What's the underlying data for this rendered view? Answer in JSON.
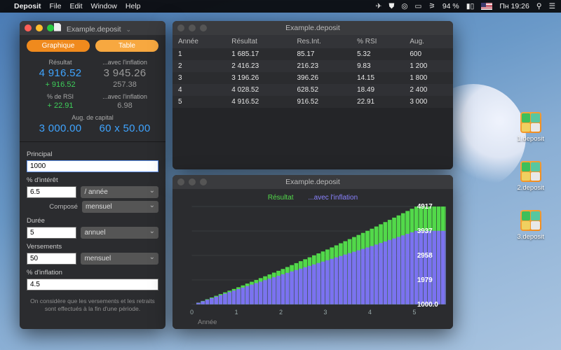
{
  "menubar": {
    "app": "Deposit",
    "items": [
      "File",
      "Edit",
      "Window",
      "Help"
    ],
    "battery": "94 %",
    "clock": "Пн 19:26"
  },
  "mainWindow": {
    "title": "Example.deposit",
    "tabs": {
      "graph": "Graphique",
      "table": "Table"
    },
    "summary": {
      "hdr_result": "Résultat",
      "hdr_infl": "...avec l'inflation",
      "result": "4 916.52",
      "result_infl": "3 945.26",
      "gain": "+ 916.52",
      "gain_infl": "257.38",
      "hdr_rsi": "% de RSI",
      "rsi": "+ 22.91",
      "rsi_infl": "6.98",
      "hdr_aug": "Aug. de capital",
      "aug": "3 000.00",
      "aug2": "60 x 50.00"
    },
    "form": {
      "principal_lbl": "Principal",
      "principal": "1000",
      "interest_lbl": "% d'intérêt",
      "interest": "6.5",
      "per_year": "/ année",
      "compound_lbl": "Composé",
      "compound": "mensuel",
      "duration_lbl": "Durée",
      "duration": "5",
      "duration_unit": "annuel",
      "payments_lbl": "Versements",
      "payments": "50",
      "payments_unit": "mensuel",
      "inflation_lbl": "% d'inflation",
      "inflation": "4.5",
      "footnote": "On considère que les versements et les retraits sont effectués à la fin d'une période."
    }
  },
  "tableWindow": {
    "title": "Example.deposit",
    "columns": [
      "Année",
      "Résultat",
      "Res.Int.",
      "% RSI",
      "Aug."
    ],
    "rows": [
      [
        "1",
        "1 685.17",
        "85.17",
        "5.32",
        "600"
      ],
      [
        "2",
        "2 416.23",
        "216.23",
        "9.83",
        "1 200"
      ],
      [
        "3",
        "3 196.26",
        "396.26",
        "14.15",
        "1 800"
      ],
      [
        "4",
        "4 028.52",
        "628.52",
        "18.49",
        "2 400"
      ],
      [
        "5",
        "4 916.52",
        "916.52",
        "22.91",
        "3 000"
      ]
    ]
  },
  "chartWindow": {
    "title": "Example.deposit",
    "legend": {
      "s1": "Résultat",
      "s2": "...avec l'inflation"
    },
    "xlabel": "Année"
  },
  "chart_data": {
    "type": "bar",
    "title": "",
    "xlabel": "Année",
    "ylabel": "",
    "categories": [
      0,
      1,
      2,
      3,
      4,
      5
    ],
    "series": [
      {
        "name": "Résultat",
        "values": [
          1000,
          1685.17,
          2416.23,
          3196.26,
          4028.52,
          4916.52
        ]
      },
      {
        "name": "...avec l'inflation",
        "values": [
          1000,
          1612,
          2205,
          2767,
          3334,
          3945.26
        ]
      }
    ],
    "yticks": [
      1000.0,
      1979,
      2958,
      3937,
      4917
    ],
    "xlim": [
      0,
      5
    ],
    "ylim": [
      1000,
      4917
    ]
  },
  "desktop": {
    "files": [
      "1.deposit",
      "2.deposit",
      "3.deposit"
    ]
  }
}
